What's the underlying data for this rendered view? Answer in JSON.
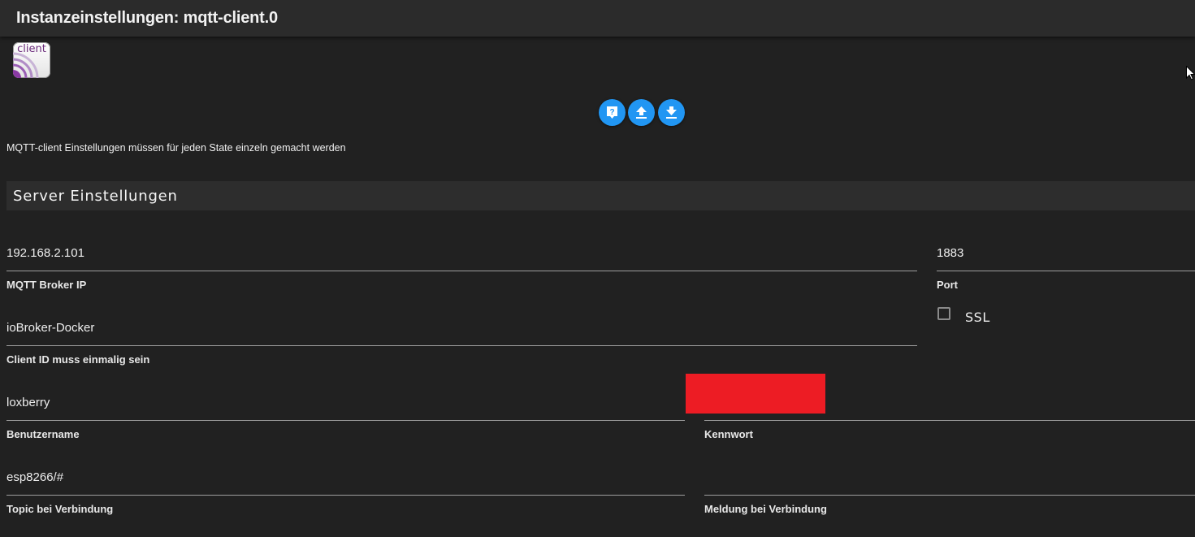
{
  "header": {
    "title": "Instanzeinstellungen: mqtt-client.0"
  },
  "logo": {
    "text": "client"
  },
  "toolbar": {
    "help_icon": "help-icon",
    "upload_icon": "upload-icon",
    "download_icon": "download-icon",
    "accent_color": "#2196f3"
  },
  "hint": "MQTT-client Einstellungen müssen für jeden State einzeln gemacht werden",
  "section": {
    "title": "Server Einstellungen"
  },
  "fields": {
    "broker_ip": {
      "value": "192.168.2.101",
      "label": "MQTT Broker IP"
    },
    "port": {
      "value": "1883",
      "label": "Port"
    },
    "client_id": {
      "value": "ioBroker-Docker",
      "label": "Client ID muss einmalig sein"
    },
    "username": {
      "value": "loxberry",
      "label": "Benutzername"
    },
    "password": {
      "value": "",
      "label": "Kennwort"
    },
    "connect_topic": {
      "value": "esp8266/#",
      "label": "Topic bei Verbindung"
    },
    "connect_message": {
      "value": "",
      "label": "Meldung bei Verbindung"
    }
  },
  "ssl": {
    "label": "SSL",
    "checked": false
  },
  "colors": {
    "background": "#212121",
    "redaction": "#ed1c24"
  }
}
